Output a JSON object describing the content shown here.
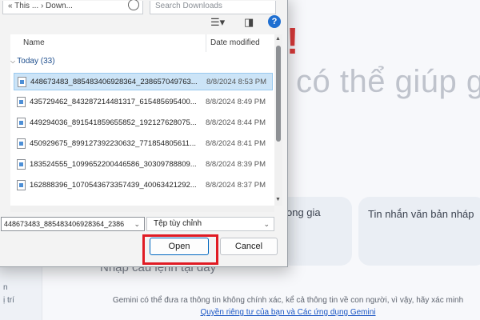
{
  "dialog": {
    "address": "« This ... › Down...",
    "search_placeholder": "Search Downloads",
    "icons": {
      "view": "view-list-icon",
      "preview": "preview-pane-icon",
      "help": "?"
    },
    "columns": {
      "name": "Name",
      "date": "Date modified"
    },
    "group_label": "Today (33)",
    "files": [
      {
        "name": "448673483_885483406928364_238657049763...",
        "date": "8/8/2024 8:53 PM",
        "selected": true
      },
      {
        "name": "435729462_843287214481317_615485695400...",
        "date": "8/8/2024 8:49 PM",
        "selected": false
      },
      {
        "name": "449294036_891541859655852_192127628075...",
        "date": "8/8/2024 8:44 PM",
        "selected": false
      },
      {
        "name": "450929675_899127392230632_771854805611...",
        "date": "8/8/2024 8:41 PM",
        "selected": false
      },
      {
        "name": "183524555_1099652200446586_30309788809...",
        "date": "8/8/2024 8:39 PM",
        "selected": false
      },
      {
        "name": "162888396_1070543673357439_40063421292...",
        "date": "8/8/2024 8:37 PM",
        "selected": false
      }
    ],
    "filename_value": "448673483_885483406928364_2386",
    "filetype_value": "Tệp tùy chỉnh",
    "open_label": "Open",
    "cancel_label": "Cancel"
  },
  "background": {
    "greeting_mark": "!",
    "heading": "có thể giúp g",
    "card1": "ong gia",
    "card2": "Tin nhắn văn bản nháp",
    "prompt_placeholder": "Nhập câu lệnh tại đây",
    "left_text1": "n",
    "left_text2": "ị trí",
    "footer_line1": "Gemini có thể đưa ra thông tin không chính xác, kể cả thông tin về con người, vì vậy, hãy xác minh",
    "footer_link": "Quyền riêng tư của bạn và Các ứng dụng Gemini"
  },
  "highlight_color": "#e01b24",
  "accent_color": "#0067c0"
}
